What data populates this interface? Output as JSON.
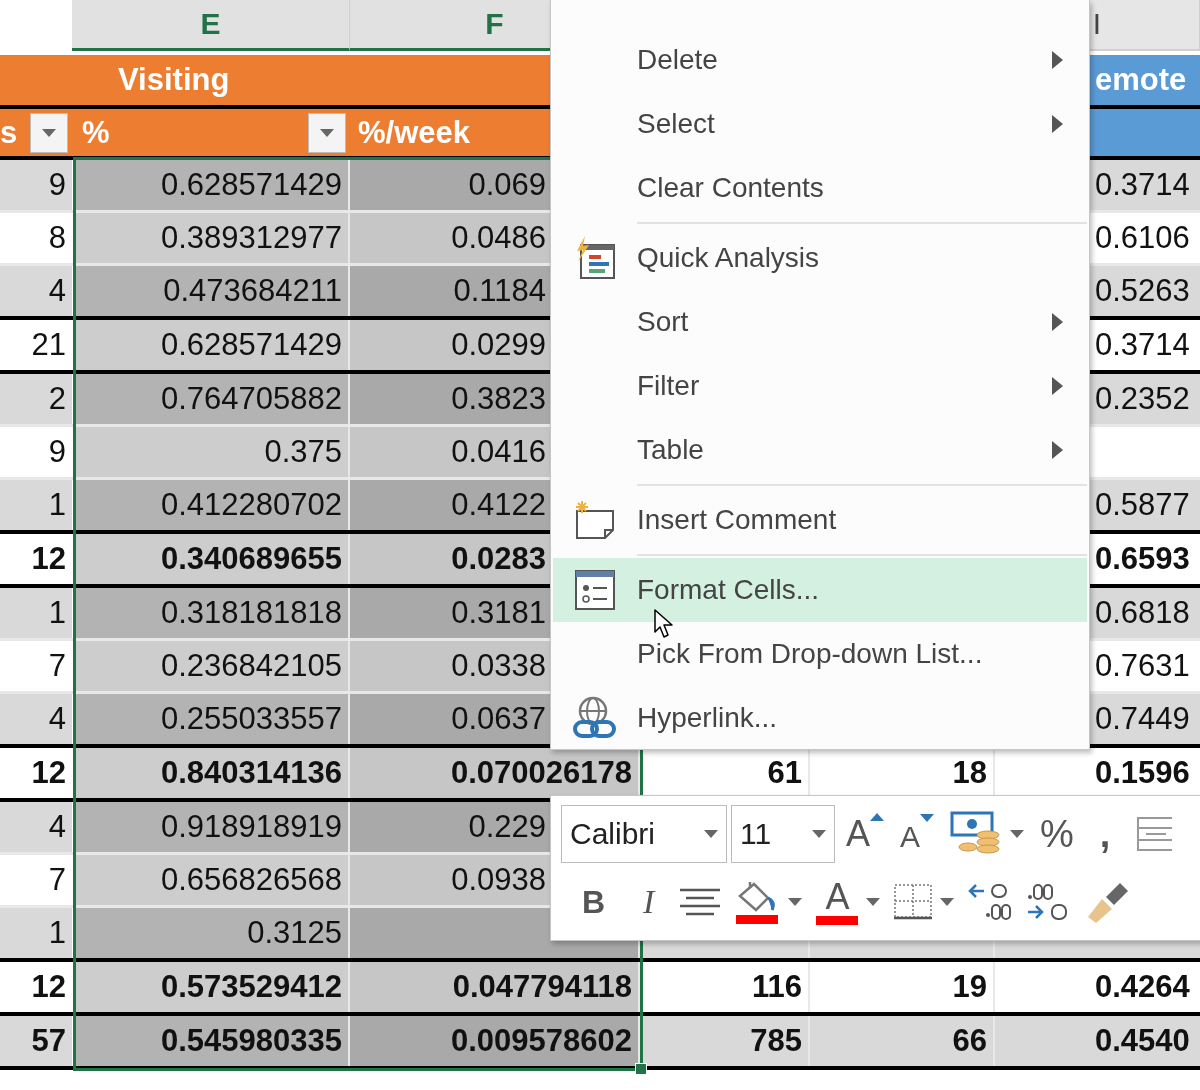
{
  "column_headers": {
    "e": {
      "label": "E",
      "selected": true
    },
    "f": {
      "label": "F",
      "selected": true
    },
    "i": {
      "label": "I",
      "selected": false
    }
  },
  "group_headers": [
    {
      "label": "Visiting",
      "color": "#ed7d31"
    },
    {
      "label": "emote",
      "color": "#5b9bd5"
    }
  ],
  "field_headers": {
    "d": {
      "label": "s",
      "filter": true
    },
    "e": {
      "label": "%",
      "filter": true
    },
    "f": {
      "label": "%/week",
      "filter": false
    }
  },
  "rows": [
    {
      "d": "9",
      "e": "0.628571429",
      "f": "0.069",
      "i": "0.3714",
      "bold": false,
      "group_end": false
    },
    {
      "d": "8",
      "e": "0.389312977",
      "f": "0.0486",
      "i": "0.6106",
      "bold": false,
      "group_end": false
    },
    {
      "d": "4",
      "e": "0.473684211",
      "f": "0.1184",
      "i": "0.5263",
      "bold": false,
      "group_end": true
    },
    {
      "d": "21",
      "e": "0.628571429",
      "f": "0.0299",
      "i": "0.3714",
      "bold": false,
      "group_end": true
    },
    {
      "d": "2",
      "e": "0.764705882",
      "f": "0.3823",
      "i": "0.2352",
      "bold": false,
      "group_end": false
    },
    {
      "d": "9",
      "e": "0.375",
      "f": "0.0416",
      "bold": false,
      "group_end": false
    },
    {
      "d": "1",
      "e": "0.412280702",
      "f": "0.4122",
      "i": "0.5877",
      "bold": false,
      "group_end": true
    },
    {
      "d": "12",
      "e": "0.340689655",
      "f": "0.0283",
      "i": "0.6593",
      "bold": true,
      "group_end": true
    },
    {
      "d": "1",
      "e": "0.318181818",
      "f": "0.3181",
      "i": "0.6818",
      "bold": false,
      "group_end": false
    },
    {
      "d": "7",
      "e": "0.236842105",
      "f": "0.0338",
      "i": "0.7631",
      "bold": false,
      "group_end": false
    },
    {
      "d": "4",
      "e": "0.255033557",
      "f": "0.0637",
      "i": "0.7449",
      "bold": false,
      "group_end": true
    },
    {
      "d": "12",
      "e": "0.840314136",
      "f": "0.070026178",
      "g": "61",
      "h": "18",
      "i": "0.1596",
      "bold": true,
      "group_end": true
    },
    {
      "d": "4",
      "e": "0.918918919",
      "f": "0.229",
      "bold": false,
      "group_end": false
    },
    {
      "d": "7",
      "e": "0.656826568",
      "f": "0.0938",
      "bold": false,
      "group_end": false
    },
    {
      "d": "1",
      "e": "0.3125",
      "bold": false,
      "group_end": true
    },
    {
      "d": "12",
      "e": "0.573529412",
      "f": "0.047794118",
      "g": "116",
      "h": "19",
      "i": "0.4264",
      "bold": true,
      "group_end": true
    },
    {
      "d": "57",
      "e": "0.545980335",
      "f": "0.009578602",
      "g": "785",
      "h": "66",
      "i": "0.4540",
      "bold": true,
      "group_end": true
    }
  ],
  "context_menu": [
    {
      "kind": "item",
      "label": "Delete",
      "submenu": true,
      "selected": false
    },
    {
      "kind": "item",
      "label": "Select",
      "submenu": true,
      "selected": false
    },
    {
      "kind": "item",
      "label": "Clear Contents",
      "submenu": false,
      "selected": false
    },
    {
      "kind": "separator"
    },
    {
      "kind": "analysis",
      "label": "Quick Analysis",
      "submenu": false,
      "selected": false
    },
    {
      "kind": "item",
      "label": "Sort",
      "submenu": true,
      "selected": false
    },
    {
      "kind": "item",
      "label": "Filter",
      "submenu": true,
      "selected": false
    },
    {
      "kind": "item",
      "label": "Table",
      "submenu": true,
      "selected": false
    },
    {
      "kind": "separator"
    },
    {
      "kind": "comment",
      "label": "Insert Comment",
      "submenu": false,
      "selected": false
    },
    {
      "kind": "separator"
    },
    {
      "kind": "format",
      "label": "Format Cells...",
      "submenu": false,
      "selected": true
    },
    {
      "kind": "item",
      "label": "Pick From Drop-down List...",
      "submenu": false,
      "selected": false
    },
    {
      "kind": "link",
      "label": "Hyperlink...",
      "submenu": false,
      "selected": false
    }
  ],
  "mini_toolbar": {
    "font": "Calibri",
    "size": "11",
    "rows": [
      [
        {
          "kind": "grow-font",
          "label": "A"
        },
        {
          "kind": "shrink-font",
          "label": "A"
        },
        {
          "kind": "accounting",
          "caret": true
        },
        {
          "kind": "percent",
          "label": "%"
        },
        {
          "kind": "comma",
          "label": ","
        },
        {
          "kind": "merge"
        }
      ],
      [
        {
          "kind": "bold",
          "label": "B"
        },
        {
          "kind": "italic",
          "label": "I"
        },
        {
          "kind": "center"
        },
        {
          "kind": "fill-color",
          "color": "#ff0000",
          "caret": true
        },
        {
          "kind": "font-color",
          "label": "A",
          "color": "#ff0000",
          "caret": true
        },
        {
          "kind": "borders",
          "caret": true
        },
        {
          "kind": "increase-decimal"
        },
        {
          "kind": "decrease-decimal"
        },
        {
          "kind": "format-painter"
        }
      ]
    ]
  }
}
